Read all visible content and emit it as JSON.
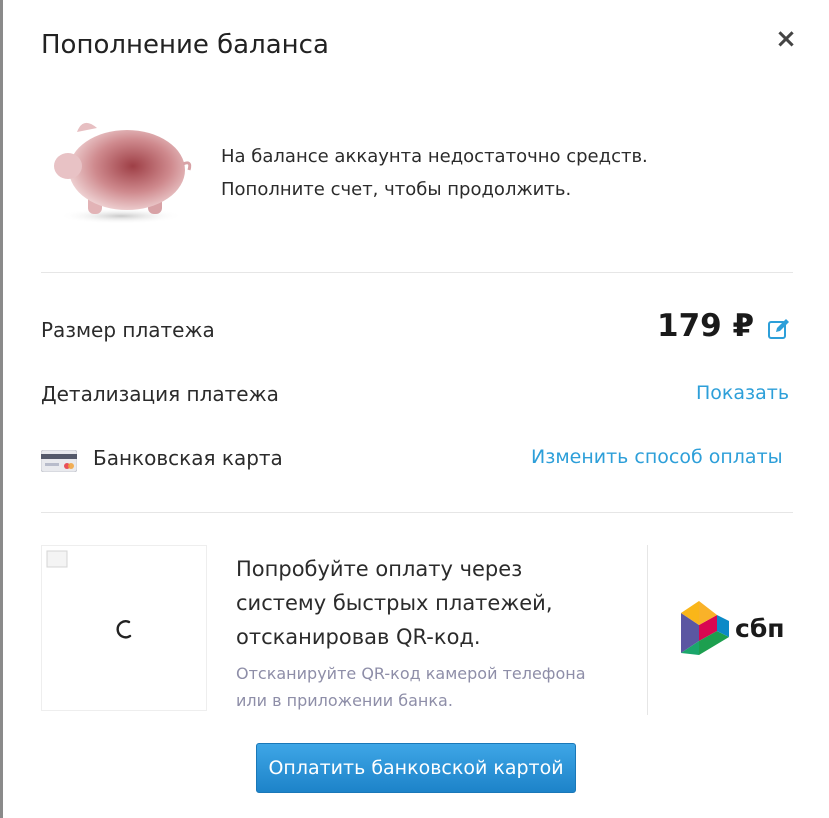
{
  "dialog": {
    "title": "Пополнение баланса",
    "close_label": "×"
  },
  "notice": {
    "line1": "На балансе аккаунта недостаточно средств.",
    "line2": "Пополните счет, чтобы продолжить."
  },
  "payment": {
    "amount_label": "Размер платежа",
    "amount_value": "179 ₽",
    "details_label": "Детализация платежа",
    "details_link": "Показать",
    "method_label": "Банковская карта",
    "change_method_link": "Изменить способ оплаты"
  },
  "sbp": {
    "line1": "Попробуйте оплату через",
    "line2": "систему быстрых платежей,",
    "line3": "отсканировав QR-код.",
    "hint1": "Отсканируйте QR-код камерой телефона",
    "hint2": "или в приложении банка.",
    "logo_text": "сбп"
  },
  "button": {
    "pay_label": "Оплатить банковской картой"
  },
  "colors": {
    "accent": "#2d9fd9",
    "button": "#2a92d6",
    "hint": "#8e8ea8"
  },
  "icons": {
    "close": "close-icon",
    "edit": "edit-icon",
    "card": "bank-card-icon",
    "pig": "piggy-bank-icon",
    "spinner": "loading-spinner-icon",
    "sbp": "sbp-logo"
  }
}
